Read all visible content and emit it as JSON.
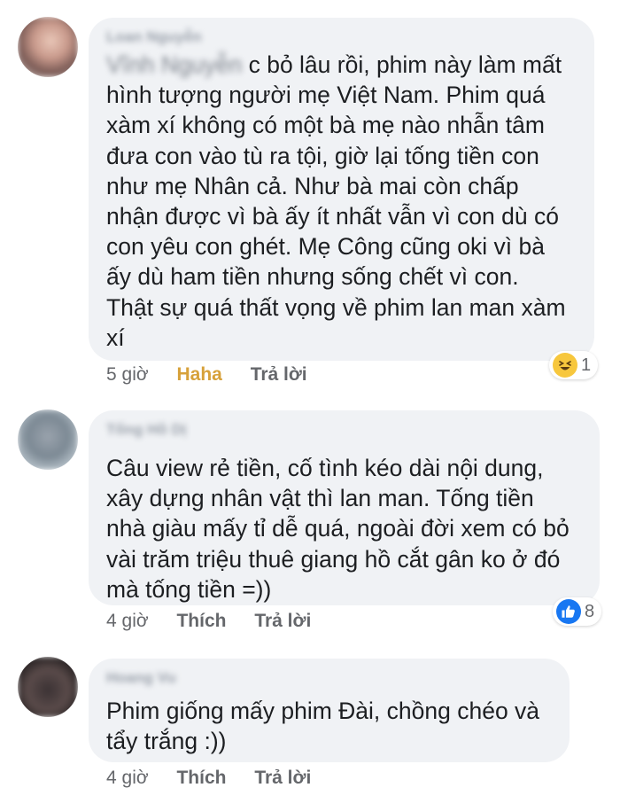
{
  "comments": [
    {
      "author": "Loan Nguyễn",
      "first_line_blurred": "Vĩnh Nguyễn",
      "first_line_tail": "c bỏ lâu rồi, phim này làm mất",
      "text": "hình tượng người mẹ Việt Nam. Phim quá\nxàm xí không có một bà mẹ nào nhẫn tâm\nđưa con vào tù ra tội, giờ lại tống tiền con\nnhư mẹ Nhân cả. Như bà mai còn chấp\nnhận được vì bà ấy ít nhất vẫn vì con dù có\ncon yêu con ghét. Mẹ Công cũng oki vì bà\nấy dù ham tiền nhưng sống chết vì con.\nThật sự quá thất vọng về phim lan man xàm\nxí",
      "time": "5 giờ",
      "action_like": "Haha",
      "action_reply": "Trả lời",
      "reaction_icon": "haha-emoji-icon",
      "reaction_count": "1"
    },
    {
      "author": "Tống Hồ Dị",
      "text": "Câu view rẻ tiền, cố tình kéo dài nội dung,\nxây dựng nhân vật thì lan man. Tống tiền\nnhà giàu mấy tỉ dễ quá, ngoài đời xem có bỏ\nvài trăm triệu thuê giang hồ cắt gân ko ở đó\nmà tống tiền =))",
      "time": "4 giờ",
      "action_like": "Thích",
      "action_reply": "Trả lời",
      "reaction_icon": "like-thumb-icon",
      "reaction_count": "8"
    },
    {
      "author": "Hoang Vu",
      "text": "Phim giống mấy phim Đài, chồng chéo và\ntẩy trắng :))",
      "time": "4 giờ",
      "action_like": "Thích",
      "action_reply": "Trả lời"
    }
  ],
  "colors": {
    "bubble": "#f0f2f5",
    "meta_text": "#65676b",
    "haha_accent": "#d7a13a",
    "like_blue": "#1877f2"
  }
}
